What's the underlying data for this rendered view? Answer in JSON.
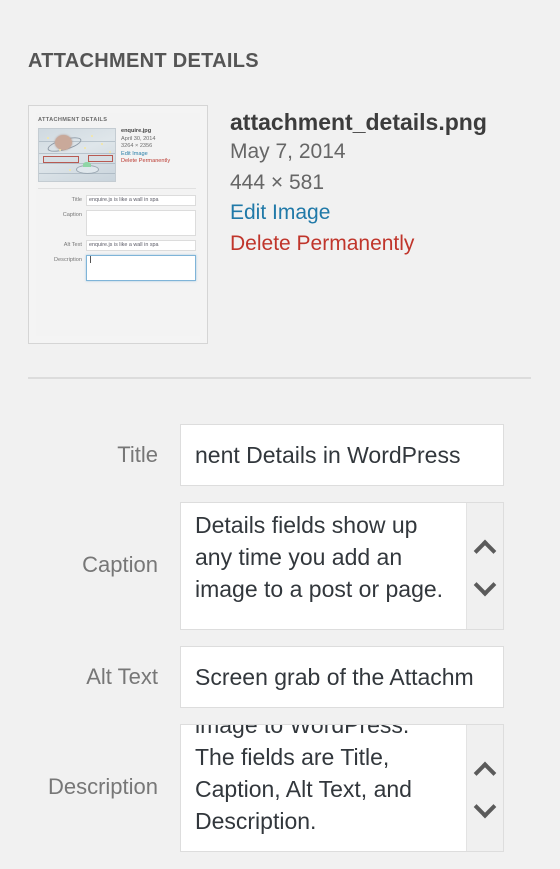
{
  "panel": {
    "title": "ATTACHMENT DETAILS"
  },
  "attachment": {
    "filename": "attachment_details.png",
    "date": "May 7, 2014",
    "dimensions": "444 × 581",
    "edit_link": "Edit Image",
    "delete_link": "Delete Permanently"
  },
  "thumbnail": {
    "title": "ATTACHMENT DETAILS",
    "filename": "enquire.jpg",
    "date": "April 30, 2014",
    "dimensions": "3264 × 2356",
    "edit_link": "Edit Image",
    "delete_link": "Delete Permanently",
    "fields": {
      "title_label": "Title",
      "title_value": "enquire.js is like a wall in spa",
      "caption_label": "Caption",
      "caption_value": "",
      "alt_label": "Alt Text",
      "alt_value": "enquire.js is like a wall in spa",
      "description_label": "Description",
      "description_value": ""
    }
  },
  "form": {
    "title": {
      "label": "Title",
      "value": "nent Details in WordPress"
    },
    "caption": {
      "label": "Caption",
      "value": "Details fields show up any time you add an image to a post or page."
    },
    "alt_text": {
      "label": "Alt Text",
      "value": "Screen grab of the Attachm"
    },
    "description": {
      "label": "Description",
      "value": "image to WordPress.\nThe fields are Title,\nCaption, Alt Text, and\nDescription."
    }
  },
  "colors": {
    "background": "#f1f1f1",
    "link": "#2079a8",
    "danger": "#c0352b",
    "label": "#777777",
    "text": "#32373c",
    "border": "#dddddd"
  }
}
